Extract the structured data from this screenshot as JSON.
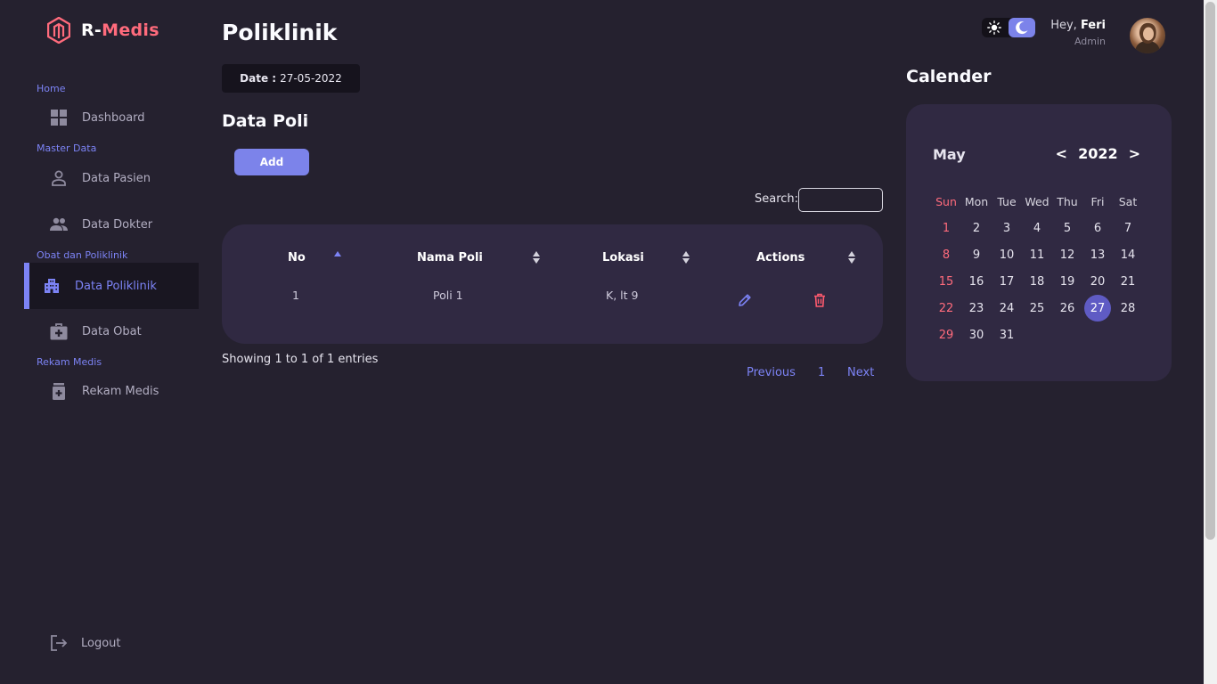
{
  "brand": {
    "prefix": "R-",
    "name": "Medis",
    "accent": "#ff6b7c"
  },
  "sidebar": {
    "sections": [
      "Home",
      "Master Data",
      "Obat dan Poliklinik",
      "Rekam Medis"
    ],
    "items": [
      {
        "label": "Dashboard",
        "icon": "grid-icon"
      },
      {
        "label": "Data Pasien",
        "icon": "user-icon"
      },
      {
        "label": "Data Dokter",
        "icon": "users-icon"
      },
      {
        "label": "Data Poliklinik",
        "icon": "building-icon",
        "active": true
      },
      {
        "label": "Data Obat",
        "icon": "medkit-icon"
      },
      {
        "label": "Rekam Medis",
        "icon": "medicine-icon"
      }
    ],
    "logout": "Logout"
  },
  "header": {
    "title": "Poliklinik",
    "date_label": "Date :",
    "date_value": "27-05-2022",
    "greeting": "Hey,",
    "user": "Feri",
    "role": "Admin"
  },
  "main": {
    "subtitle": "Data Poli",
    "add_label": "Add",
    "search_label": "Search:",
    "search_value": "",
    "columns": [
      "No",
      "Nama Poli",
      "Lokasi",
      "Actions"
    ],
    "rows": [
      {
        "no": "1",
        "nama_poli": "Poli 1",
        "lokasi": "K, lt 9"
      }
    ],
    "entries_text": "Showing 1 to 1 of 1 entries",
    "pager": {
      "previous": "Previous",
      "page": "1",
      "next": "Next"
    }
  },
  "calendar": {
    "title": "Calender",
    "month": "May",
    "year": "2022",
    "prev": "<",
    "next": ">",
    "weekdays": [
      "Sun",
      "Mon",
      "Tue",
      "Wed",
      "Thu",
      "Fri",
      "Sat"
    ],
    "first_weekday_index": 0,
    "days_in_month": 31,
    "today": 27
  },
  "colors": {
    "accent": "#7c83f5",
    "background": "#25212f",
    "card": "#302942",
    "danger": "#ff6b7c"
  }
}
